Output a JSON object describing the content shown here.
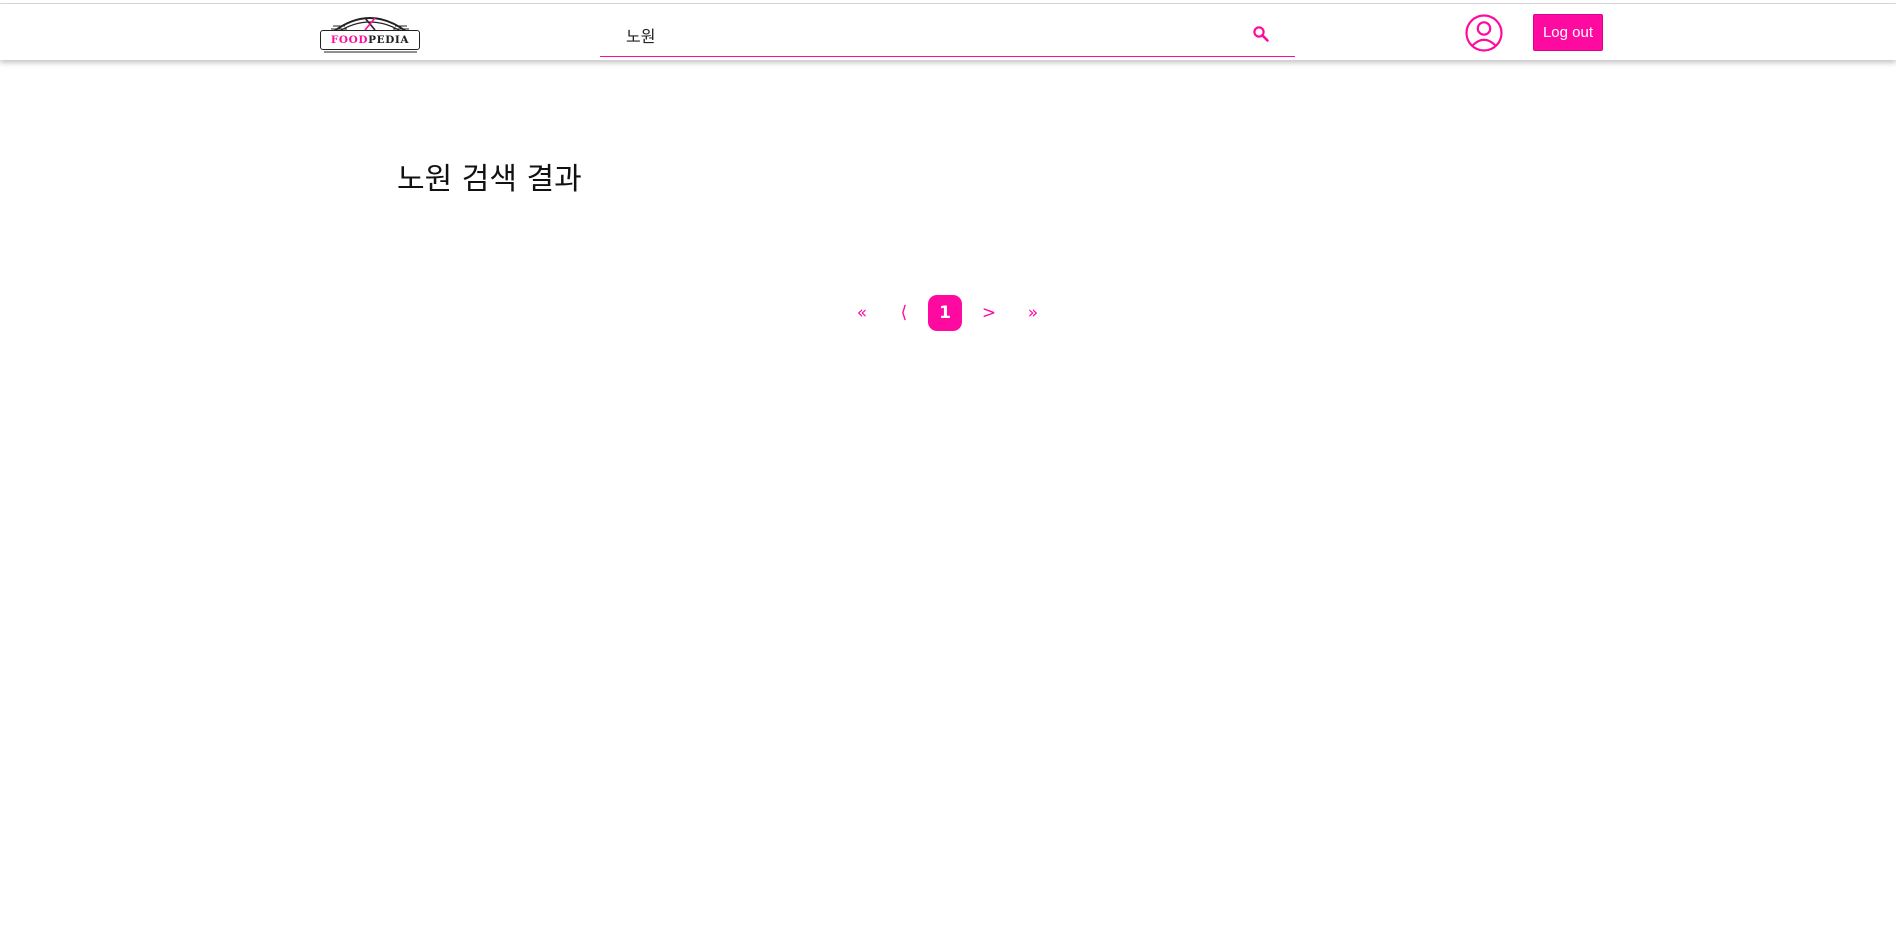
{
  "header": {
    "logo": {
      "text_part1": "FOOD",
      "text_part2": "PEDIA",
      "icon": "crossed-fork-knife-icon"
    },
    "search": {
      "value": "노원",
      "icon": "search-icon"
    },
    "avatar_icon": "user-circle-icon",
    "logout_label": "Log out"
  },
  "main": {
    "title": "노원 검색 결과"
  },
  "pagination": {
    "first_label": "«",
    "prev_label": "⟨",
    "current_page": "1",
    "next_label": ">",
    "last_label": "»"
  },
  "colors": {
    "accent": "#ff0aa0",
    "text": "#111111",
    "background": "#ffffff"
  }
}
